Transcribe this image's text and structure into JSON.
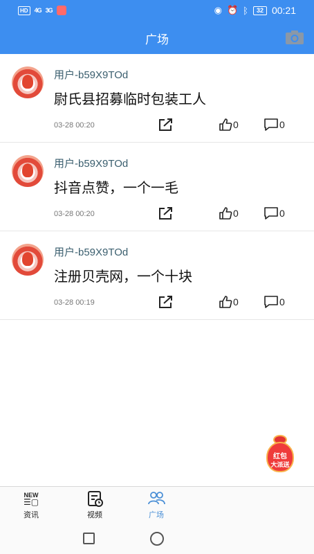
{
  "status_bar": {
    "net_tag": "HD",
    "signal1": "4G",
    "signal2": "3G",
    "battery": "32",
    "time": "00:21"
  },
  "header": {
    "title": "广场"
  },
  "posts": [
    {
      "username": "用户-b59X9TOd",
      "content": "尉氏县招募临时包装工人",
      "time": "03-28 00:20",
      "likes": "0",
      "comments": "0"
    },
    {
      "username": "用户-b59X9TOd",
      "content": "抖音点赞，一个一毛",
      "time": "03-28 00:20",
      "likes": "0",
      "comments": "0"
    },
    {
      "username": "用户-b59X9TOd",
      "content": "注册贝壳网，一个十块",
      "time": "03-28 00:19",
      "likes": "0",
      "comments": "0"
    }
  ],
  "red_packet": {
    "line1": "红包",
    "line2": "大派送"
  },
  "bottom_nav": {
    "items": [
      {
        "label": "资讯",
        "icon": "news-icon",
        "badge": "NEW"
      },
      {
        "label": "视频",
        "icon": "video-icon"
      },
      {
        "label": "广场",
        "icon": "community-icon"
      }
    ],
    "active": "广场"
  },
  "colors": {
    "primary": "#3d8ef0",
    "active_tab": "#4a8fd6"
  }
}
